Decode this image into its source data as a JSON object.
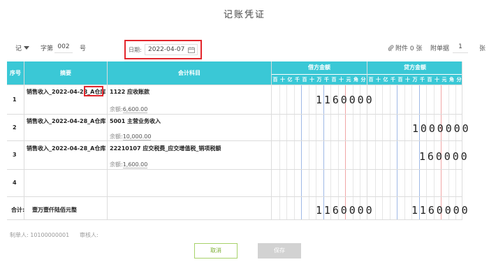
{
  "title": "记账凭证",
  "header": {
    "word_select": "记",
    "word_label": "字第",
    "voucher_no": "002",
    "no_label": "号",
    "date_label": "日期:",
    "date_value": "2022-04-07",
    "attach_label": "附件 0 张",
    "bill_label": "附单据",
    "bill_count": "1",
    "bill_unit": "张"
  },
  "table": {
    "col_seq": "序号",
    "col_summary": "摘要",
    "col_account": "会计科目",
    "col_debit": "借方金额",
    "col_credit": "贷方金额",
    "digit_units": [
      "百",
      "十",
      "亿",
      "千",
      "百",
      "十",
      "万",
      "千",
      "百",
      "十",
      "元",
      "角",
      "分"
    ],
    "rows": [
      {
        "seq": "1",
        "summary": "销售收入_2022-04-28_A仓库",
        "account": "1122 应收账款",
        "balance_label": "余额:",
        "balance": "6,600.00",
        "debit": "1160000",
        "credit": ""
      },
      {
        "seq": "2",
        "summary": "销售收入_2022-04-28_A仓库",
        "account": "5001 主营业务收入",
        "balance_label": "余额:",
        "balance": "10,000.00",
        "debit": "",
        "credit": "1000000"
      },
      {
        "seq": "3",
        "summary": "销售收入_2022-04-28_A仓库",
        "account": "22210107 应交税费_应交增值税_销项税额",
        "balance_label": "余额:",
        "balance": "1,600.00",
        "debit": "",
        "credit": "160000"
      },
      {
        "seq": "4",
        "summary": "",
        "account": "",
        "balance_label": "",
        "balance": "",
        "debit": "",
        "credit": ""
      }
    ],
    "total_label": "合计:",
    "total_text": "壹万壹仟陆佰元整",
    "total_debit": "1160000",
    "total_credit": "1160000"
  },
  "footer": {
    "maker": "制单人: 10100000001",
    "auditor": "审核人:"
  },
  "buttons": {
    "cancel": "取消",
    "save": "保存"
  },
  "colors": {
    "header_bg": "#3ac8d6",
    "highlight": "#e3262c",
    "cancel_border": "#a7d26a"
  }
}
